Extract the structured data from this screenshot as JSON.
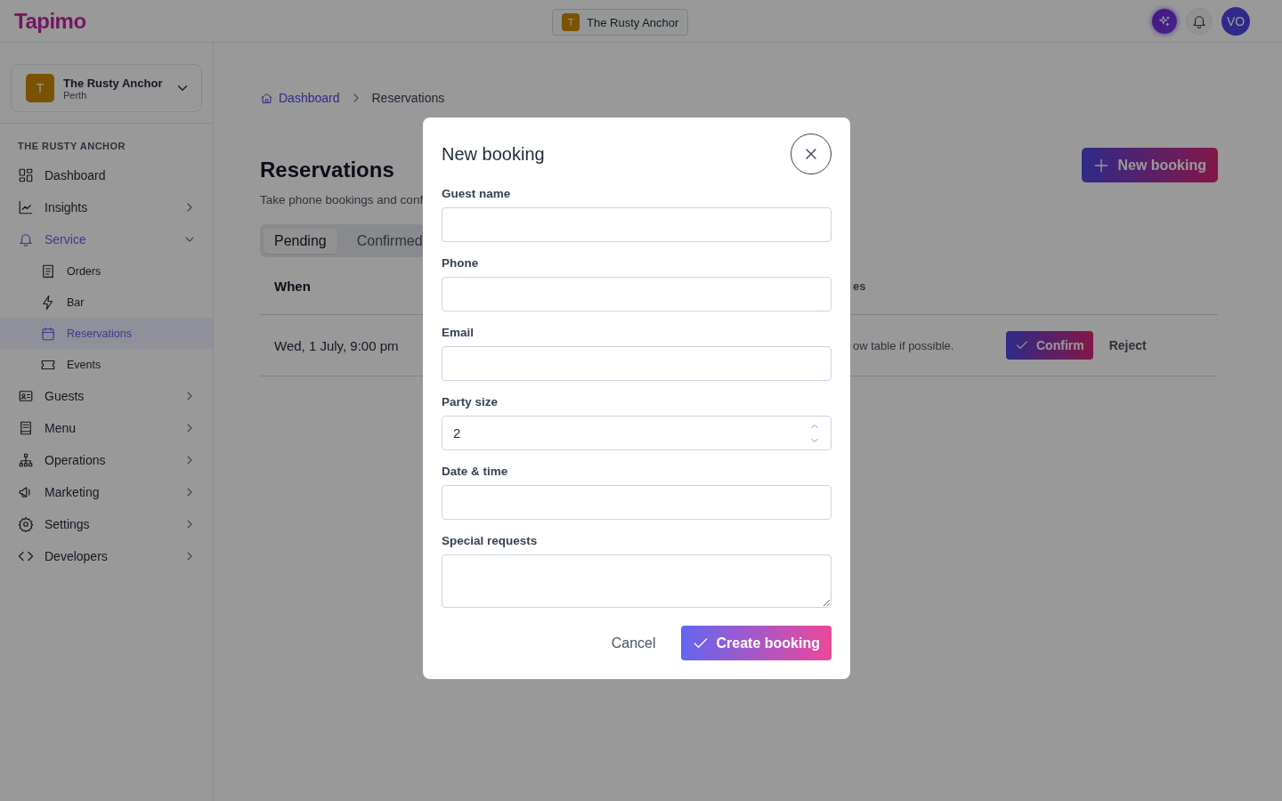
{
  "header": {
    "logo": "Tapimo",
    "venue_chip": {
      "badge": "T",
      "name": "The Rusty Anchor"
    },
    "avatar": "VO"
  },
  "sidebar": {
    "venue": {
      "badge": "T",
      "name": "The Rusty Anchor",
      "city": "Perth"
    },
    "section_label": "THE RUSTY ANCHOR",
    "items": [
      {
        "label": "Dashboard",
        "kind": "link",
        "selected": false
      },
      {
        "label": "Insights",
        "kind": "group",
        "expanded": false,
        "selected": false
      },
      {
        "label": "Service",
        "kind": "group",
        "expanded": true,
        "selected": true,
        "children": [
          {
            "label": "Orders",
            "selected": false
          },
          {
            "label": "Bar",
            "selected": false
          },
          {
            "label": "Reservations",
            "selected": true
          },
          {
            "label": "Events",
            "selected": false
          }
        ]
      },
      {
        "label": "Guests",
        "kind": "group",
        "expanded": false,
        "selected": false
      },
      {
        "label": "Menu",
        "kind": "group",
        "expanded": false,
        "selected": false
      },
      {
        "label": "Operations",
        "kind": "group",
        "expanded": false,
        "selected": false
      },
      {
        "label": "Marketing",
        "kind": "group",
        "expanded": false,
        "selected": false
      },
      {
        "label": "Settings",
        "kind": "group",
        "expanded": false,
        "selected": false
      },
      {
        "label": "Developers",
        "kind": "group",
        "expanded": false,
        "selected": false
      }
    ]
  },
  "main": {
    "breadcrumb": [
      {
        "label": "Dashboard",
        "kind": "link"
      },
      {
        "label": "Reservations",
        "kind": "current"
      }
    ],
    "title": "Reservations",
    "subtitle": "Take phone bookings and conf",
    "new_button": "New booking",
    "tabs": [
      {
        "label": "Pending",
        "selected": true
      },
      {
        "label": "Confirmed",
        "selected": false
      }
    ],
    "table": {
      "columns": [
        "When",
        "es"
      ],
      "rows": [
        {
          "when": "Wed, 1 July, 9:00 pm",
          "notes": "ow table if possible.",
          "confirm": "Confirm",
          "reject": "Reject"
        }
      ]
    }
  },
  "modal": {
    "title": "New booking",
    "fields": [
      {
        "label": "Guest name",
        "kind": "text"
      },
      {
        "label": "Phone",
        "kind": "text"
      },
      {
        "label": "Email",
        "kind": "text"
      },
      {
        "label": "Party size",
        "kind": "number",
        "value": "2"
      },
      {
        "label": "Date & time",
        "kind": "text"
      },
      {
        "label": "Special requests",
        "kind": "textarea"
      }
    ],
    "cancel": "Cancel",
    "submit": "Create booking"
  }
}
